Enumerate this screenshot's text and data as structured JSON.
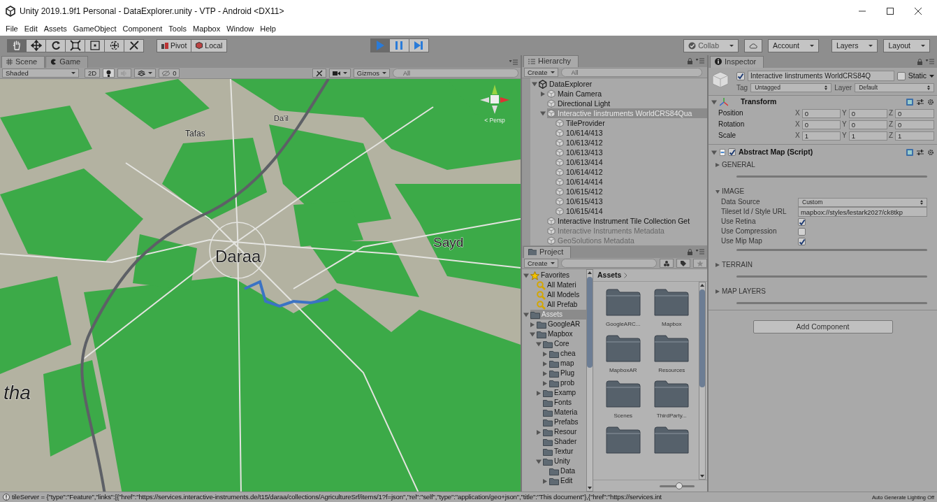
{
  "window": {
    "title": "Unity 2019.1.9f1 Personal - DataExplorer.unity - VTP - Android <DX11>"
  },
  "menu": [
    "File",
    "Edit",
    "Assets",
    "GameObject",
    "Component",
    "Tools",
    "Mapbox",
    "Window",
    "Help"
  ],
  "toolbar": {
    "tools": [
      {
        "kind": "hand",
        "selected": true
      },
      {
        "kind": "move",
        "selected": false
      },
      {
        "kind": "rotate",
        "selected": false
      },
      {
        "kind": "scale",
        "selected": false
      },
      {
        "kind": "rect",
        "selected": false
      },
      {
        "kind": "transform",
        "selected": false
      },
      {
        "kind": "custom",
        "selected": false
      }
    ],
    "pivot": "Pivot",
    "local": "Local",
    "playback": [
      {
        "kind": "play",
        "on": true
      },
      {
        "kind": "pause",
        "on": false
      },
      {
        "kind": "step",
        "on": false
      }
    ],
    "collab": "Collab",
    "account": "Account",
    "layers": "Layers",
    "layout": "Layout"
  },
  "scene": {
    "tabs": [
      {
        "label": "Scene",
        "selected": true
      },
      {
        "label": "Game",
        "selected": false
      }
    ],
    "shading": "Shaded",
    "mode_2d": "2D",
    "lighting": {
      "on": true
    },
    "audio": {
      "on": false
    },
    "tool_handles": {
      "on": false
    },
    "hidden_count": "0",
    "gizmos": "Gizmos",
    "search": {
      "placeholder": "All"
    },
    "map_labels": [
      "Tafas",
      "Da'il",
      "Daraa",
      "Sayd",
      "tha"
    ],
    "projection": "< Persp"
  },
  "hierarchy": {
    "tab": "Hierarchy",
    "create": "Create",
    "search": {
      "placeholder": "All"
    },
    "items": [
      {
        "kind": "scene",
        "label": "DataExplorer",
        "expanded": true,
        "selected": false,
        "disabled": false,
        "children": [
          {
            "kind": "object",
            "label": "Main Camera",
            "expanded": false,
            "selected": false,
            "disabled": false
          },
          {
            "kind": "object",
            "label": "Directional Light",
            "selected": false,
            "disabled": false
          },
          {
            "kind": "object",
            "label": "Interactive Iinstruments WorldCRS84Qua",
            "expanded": true,
            "selected": true,
            "disabled": false,
            "children": [
              {
                "kind": "object",
                "label": "TileProvider",
                "selected": false,
                "disabled": false
              },
              {
                "kind": "object",
                "label": "10/614/413",
                "selected": false,
                "disabled": false
              },
              {
                "kind": "object",
                "label": "10/613/412",
                "selected": false,
                "disabled": false
              },
              {
                "kind": "object",
                "label": "10/613/413",
                "selected": false,
                "disabled": false
              },
              {
                "kind": "object",
                "label": "10/613/414",
                "selected": false,
                "disabled": false
              },
              {
                "kind": "object",
                "label": "10/614/412",
                "selected": false,
                "disabled": false
              },
              {
                "kind": "object",
                "label": "10/614/414",
                "selected": false,
                "disabled": false
              },
              {
                "kind": "object",
                "label": "10/615/412",
                "selected": false,
                "disabled": false
              },
              {
                "kind": "object",
                "label": "10/615/413",
                "selected": false,
                "disabled": false
              },
              {
                "kind": "object",
                "label": "10/615/414",
                "selected": false,
                "disabled": false
              }
            ]
          },
          {
            "kind": "object",
            "label": "Interactive Instrument Tile Collection Get",
            "selected": false,
            "disabled": false
          },
          {
            "kind": "object",
            "label": "Interactive Instruments Metadata",
            "selected": false,
            "disabled": true
          },
          {
            "kind": "object",
            "label": "GeoSolutions Metadata",
            "selected": false,
            "disabled": true
          }
        ]
      }
    ]
  },
  "project": {
    "tab": "Project",
    "create": "Create",
    "tree": [
      {
        "kind": "favorites",
        "label": "Favorites",
        "expanded": true,
        "selected": false,
        "children": [
          {
            "kind": "search",
            "label": "All Materi",
            "selected": false
          },
          {
            "kind": "search",
            "label": "All Models",
            "selected": false
          },
          {
            "kind": "search",
            "label": "All Prefab",
            "selected": false
          }
        ]
      },
      {
        "kind": "folder",
        "label": "Assets",
        "expanded": true,
        "selected": true,
        "children": [
          {
            "kind": "folder",
            "label": "GoogleAR",
            "expanded": false,
            "selected": false
          },
          {
            "kind": "folder",
            "label": "Mapbox",
            "expanded": true,
            "selected": false,
            "children": [
              {
                "kind": "folder",
                "label": "Core",
                "expanded": true,
                "selected": false,
                "children": [
                  {
                    "kind": "folder",
                    "label": "chea",
                    "expanded": false,
                    "selected": false
                  },
                  {
                    "kind": "folder",
                    "label": "map",
                    "expanded": false,
                    "selected": false
                  },
                  {
                    "kind": "folder",
                    "label": "Plug",
                    "expanded": false,
                    "selected": false
                  },
                  {
                    "kind": "folder",
                    "label": "prob",
                    "expanded": false,
                    "selected": false
                  }
                ]
              },
              {
                "kind": "folder",
                "label": "Examp",
                "expanded": false,
                "selected": false
              },
              {
                "kind": "folder",
                "label": "Fonts",
                "selected": false
              },
              {
                "kind": "folder",
                "label": "Materia",
                "selected": false
              },
              {
                "kind": "folder",
                "label": "Prefabs",
                "selected": false
              },
              {
                "kind": "folder",
                "label": "Resour",
                "expanded": false,
                "selected": false
              },
              {
                "kind": "folder",
                "label": "Shader",
                "selected": false
              },
              {
                "kind": "folder",
                "label": "Textur",
                "selected": false
              },
              {
                "kind": "folder",
                "label": "Unity",
                "expanded": true,
                "selected": false,
                "children": [
                  {
                    "kind": "folder",
                    "label": "Data",
                    "selected": false
                  },
                  {
                    "kind": "folder",
                    "label": "Edit",
                    "expanded": false,
                    "selected": false
                  }
                ]
              }
            ]
          }
        ]
      }
    ],
    "breadcrumb": "Assets",
    "folders": [
      {
        "kind": "named",
        "label": "GoogleARC..."
      },
      {
        "kind": "named",
        "label": "Mapbox"
      },
      {
        "kind": "named",
        "label": "MapboxAR"
      },
      {
        "kind": "named",
        "label": "Resources"
      },
      {
        "kind": "named",
        "label": "Scenes"
      },
      {
        "kind": "named",
        "label": "ThirdParty..."
      },
      {
        "kind": "cut_off"
      },
      {
        "kind": "cut_off"
      }
    ],
    "zoom": {
      "level": 0.55
    }
  },
  "inspector": {
    "tab": "Inspector",
    "object": {
      "active": true,
      "name": "Interactive Iinstruments WorldCRS84Q",
      "static_label": "Static",
      "static": false,
      "tag_label": "Tag",
      "tag": "Untagged",
      "layer_label": "Layer",
      "layer": "Default"
    },
    "transform": {
      "title": "Transform",
      "expanded": true,
      "rows": [
        {
          "label": "Position",
          "values": [
            {
              "axis": "X",
              "value": "0"
            },
            {
              "axis": "Y",
              "value": "0"
            },
            {
              "axis": "Z",
              "value": "0"
            }
          ]
        },
        {
          "label": "Rotation",
          "values": [
            {
              "axis": "X",
              "value": "0"
            },
            {
              "axis": "Y",
              "value": "0"
            },
            {
              "axis": "Z",
              "value": "0"
            }
          ]
        },
        {
          "label": "Scale",
          "values": [
            {
              "axis": "X",
              "value": "1"
            },
            {
              "axis": "Y",
              "value": "1"
            },
            {
              "axis": "Z",
              "value": "1"
            }
          ]
        }
      ]
    },
    "script": {
      "title": "Abstract Map (Script)",
      "expanded": true,
      "enabled": true,
      "sections": [
        {
          "title": "GENERAL",
          "expanded": false
        },
        {
          "title": "IMAGE",
          "expanded": true,
          "fields": [
            {
              "kind": "dropdown",
              "label": "Data Source",
              "value": "Custom"
            },
            {
              "kind": "text",
              "label": "Tileset Id / Style URL",
              "value": "mapbox://styles/lestark2027/ck8tkp"
            },
            {
              "kind": "checkbox",
              "label": "Use Retina",
              "checked": true
            },
            {
              "kind": "checkbox",
              "label": "Use Compression",
              "checked": false
            },
            {
              "kind": "checkbox",
              "label": "Use Mip Map",
              "checked": true
            }
          ]
        },
        {
          "title": "TERRAIN",
          "expanded": false
        },
        {
          "title": "MAP LAYERS",
          "expanded": false
        }
      ]
    },
    "add_component": "Add Component"
  },
  "status": {
    "message": "tileServer = {\"type\":\"Feature\",\"links\":[{\"href\":\"https://services.interactive-instruments.de/t15/daraa/collections/AgricultureSrf/items/1?f=json\",\"rel\":\"self\",\"type\":\"application/geo+json\",\"title\":\"This document\"},{\"href\":\"https://services.int",
    "lighting": "Auto Generate Lighting Off"
  }
}
